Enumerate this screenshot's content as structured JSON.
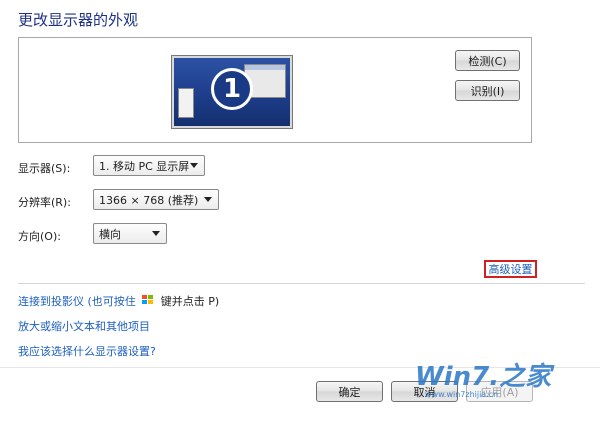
{
  "title": "更改显示器的外观",
  "preview": {
    "monitor_number": "1",
    "detect_label": "检测(C)",
    "identify_label": "识别(I)"
  },
  "settings": {
    "display_label": "显示器(S):",
    "display_value": "1. 移动 PC 显示屏",
    "resolution_label": "分辨率(R):",
    "resolution_value": "1366 × 768 (推荐)",
    "orientation_label": "方向(O):",
    "orientation_value": "横向"
  },
  "advanced_link": "高级设置",
  "links": {
    "projector_prefix": "连接到投影仪 (也可按住",
    "projector_suffix": "键并点击 P)",
    "text_size": "放大或缩小文本和其他项目",
    "which_setting": "我应该选择什么显示器设置?"
  },
  "footer": {
    "ok_label": "确定",
    "cancel_label": "取消",
    "apply_label": "应用(A)"
  },
  "watermark": {
    "text": "Win7.之家",
    "url": "www.win7zhijia.cn"
  },
  "colors": {
    "title": "#1e3287",
    "link": "#1d5fbf",
    "highlight_box": "#d21f1f"
  },
  "icons": {
    "windows_key": "windows-flag-icon",
    "dropdown": "chevron-down-icon"
  }
}
